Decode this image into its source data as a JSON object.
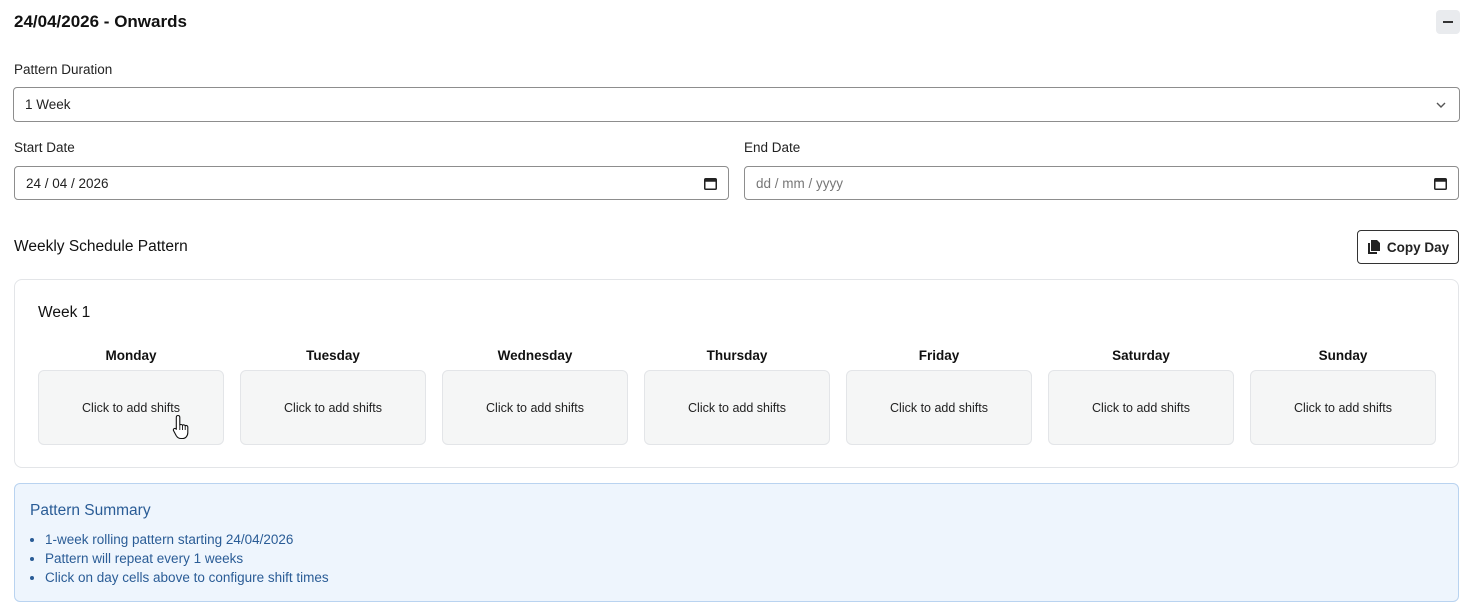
{
  "header": {
    "title": "24/04/2026 - Onwards",
    "collapse_icon": "minus-icon"
  },
  "pattern_duration": {
    "label": "Pattern Duration",
    "value": "1 Week"
  },
  "start_date": {
    "label": "Start Date",
    "value": "24 / 04 / 2026"
  },
  "end_date": {
    "label": "End Date",
    "placeholder": "dd / mm / yyyy"
  },
  "schedule": {
    "title": "Weekly Schedule Pattern",
    "copy_day_label": "Copy Day"
  },
  "week": {
    "title": "Week 1",
    "days": [
      {
        "name": "Monday",
        "cell": "Click to add shifts"
      },
      {
        "name": "Tuesday",
        "cell": "Click to add shifts"
      },
      {
        "name": "Wednesday",
        "cell": "Click to add shifts"
      },
      {
        "name": "Thursday",
        "cell": "Click to add shifts"
      },
      {
        "name": "Friday",
        "cell": "Click to add shifts"
      },
      {
        "name": "Saturday",
        "cell": "Click to add shifts"
      },
      {
        "name": "Sunday",
        "cell": "Click to add shifts"
      }
    ]
  },
  "summary": {
    "title": "Pattern Summary",
    "items": [
      "1-week rolling pattern starting 24/04/2026",
      "Pattern will repeat every 1 weeks",
      "Click on day cells above to configure shift times"
    ]
  },
  "colors": {
    "summary_bg": "#eef5fd",
    "summary_text": "#2a5c96",
    "cell_bg": "#f5f6f6"
  }
}
